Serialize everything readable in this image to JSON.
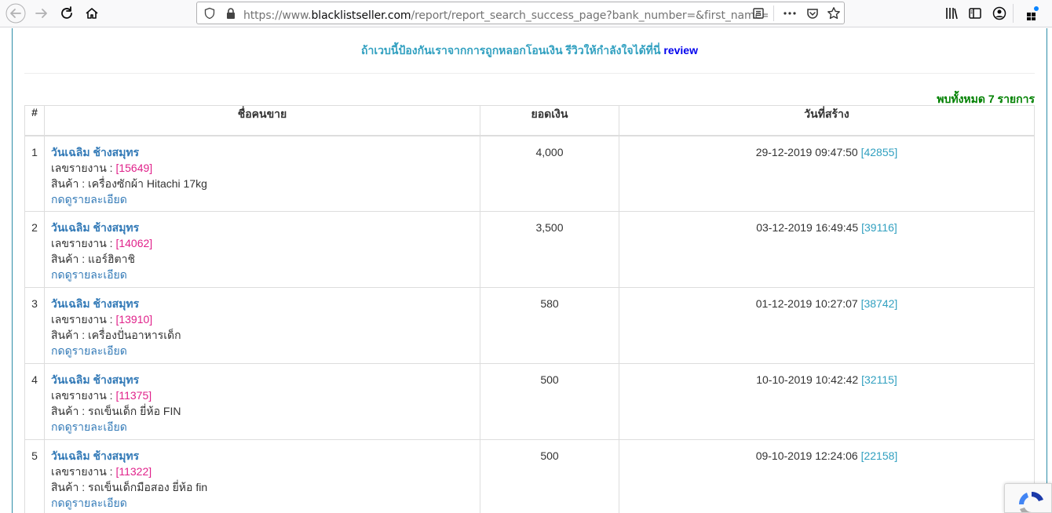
{
  "browser": {
    "url_prefix": "https://www.",
    "url_host": "blacklistseller.com",
    "url_path": "/report/report_search_success_page?bank_number=&first_name=วันเ"
  },
  "banner": {
    "text": "ถ้าเวบนี้ป้องกันเราจากการถูกหลอกโอนเงิน รีวิวให้กำลังใจได้ที่นี่",
    "link": "review"
  },
  "found_text": "พบทั้งหมด 7 รายการ",
  "table": {
    "headers": [
      "#",
      "ชื่อคนขาย",
      "ยอดเงิน",
      "วันที่สร้าง"
    ],
    "rows": [
      {
        "no": "1",
        "seller": "วันเฉลิม ช้างสมุทร",
        "report_label": "เลขรายงาน : ",
        "report_id": "[15649]",
        "product": "สินค้า : เครื่องซักผ้า Hitachi 17kg",
        "detail": "กดดูรายละเอียด",
        "amount": "4,000",
        "date": "29-12-2019 09:47:50",
        "date_id": "[42855]"
      },
      {
        "no": "2",
        "seller": "วันเฉลิม ช้างสมุทร",
        "report_label": "เลขรายงาน : ",
        "report_id": "[14062]",
        "product": "สินค้า : แอร์ฮิตาชิ",
        "detail": "กดดูรายละเอียด",
        "amount": "3,500",
        "date": "03-12-2019 16:49:45",
        "date_id": "[39116]"
      },
      {
        "no": "3",
        "seller": "วันเฉลิม ช้างสมุทร",
        "report_label": "เลขรายงาน : ",
        "report_id": "[13910]",
        "product": "สินค้า : เครื่องปั่นอาหารเด็ก",
        "detail": "กดดูรายละเอียด",
        "amount": "580",
        "date": "01-12-2019 10:27:07",
        "date_id": "[38742]"
      },
      {
        "no": "4",
        "seller": "วันเฉลิม ช้างสมุทร",
        "report_label": "เลขรายงาน : ",
        "report_id": "[11375]",
        "product": "สินค้า : รถเข็นเด็ก ยี่ห้อ FIN",
        "detail": "กดดูรายละเอียด",
        "amount": "500",
        "date": "10-10-2019 10:42:42",
        "date_id": "[32115]"
      },
      {
        "no": "5",
        "seller": "วันเฉลิม ช้างสมุทร",
        "report_label": "เลขรายงาน : ",
        "report_id": "[11322]",
        "product": "สินค้า : รถเข็นเด็กมือสอง ยี่ห้อ fin",
        "detail": "กดดูรายละเอียด",
        "amount": "500",
        "date": "09-10-2019 12:24:06",
        "date_id": "[22158]"
      }
    ]
  },
  "colors": {
    "banner": "#31a0c0",
    "link": "#337ab7",
    "report_id": "#e0218a",
    "found": "#008000",
    "frame": "#2d8da8"
  }
}
